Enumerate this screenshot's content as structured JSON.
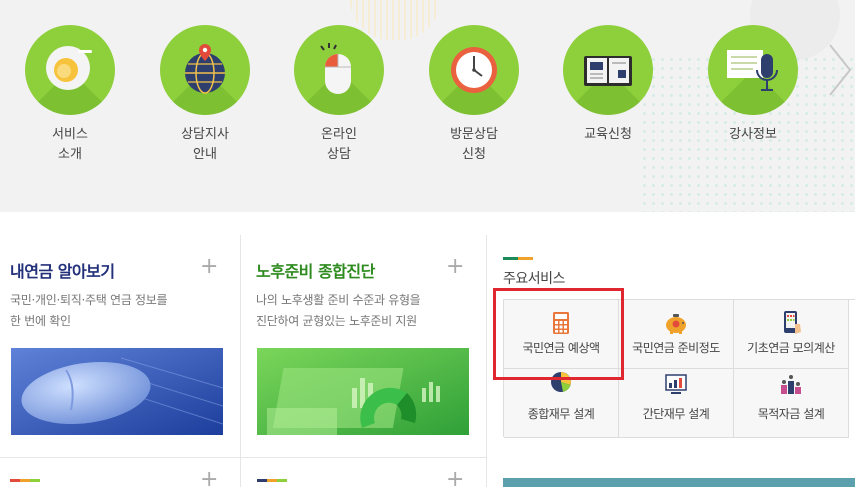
{
  "top_services": [
    {
      "label_line1": "서비스",
      "label_line2": "소개",
      "icon": "plate-icon"
    },
    {
      "label_line1": "상담지사",
      "label_line2": "안내",
      "icon": "globe-pin-icon"
    },
    {
      "label_line1": "온라인",
      "label_line2": "상담",
      "icon": "mouse-icon"
    },
    {
      "label_line1": "방문상담",
      "label_line2": "신청",
      "icon": "clock-icon"
    },
    {
      "label_line1": "교육신청",
      "label_line2": "",
      "icon": "book-icon"
    },
    {
      "label_line1": "강사정보",
      "label_line2": "",
      "icon": "microphone-icon"
    }
  ],
  "cards": {
    "my_pension": {
      "title": "내연금 알아보기",
      "desc_line1": "국민·개인·퇴직·주택 연금 정보를",
      "desc_line2": "한 번에 확인"
    },
    "retirement": {
      "title": "노후준비 종합진단",
      "desc_line1": "나의 노후생활 준비 수준과 유형을",
      "desc_line2": "진단하여 균형있는 노후준비 지원"
    }
  },
  "main_services": {
    "title": "주요서비스",
    "items": [
      {
        "label": "국민연금 예상액",
        "icon": "calculator-icon"
      },
      {
        "label": "국민연금 준비정도",
        "icon": "piggy-bank-icon"
      },
      {
        "label": "기초연금 모의계산",
        "icon": "phone-calc-icon"
      },
      {
        "label": "종합재무 설계",
        "icon": "pie-chart-icon"
      },
      {
        "label": "간단재무 설계",
        "icon": "bar-chart-icon"
      },
      {
        "label": "목적자금 설계",
        "icon": "podium-icon"
      }
    ]
  },
  "colors": {
    "accent_green": "#8ecf3c",
    "title_navy": "#23307a",
    "title_green": "#2e8b1f",
    "highlight_red": "#e0262e"
  }
}
